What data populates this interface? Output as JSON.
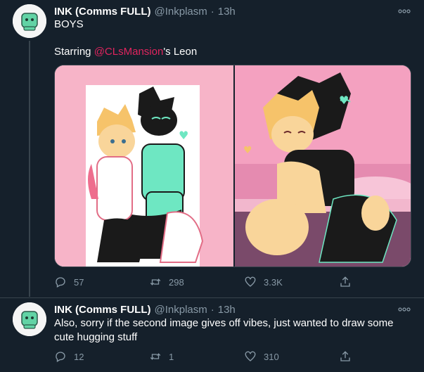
{
  "tweets": [
    {
      "author_name": "INK (Comms FULL)",
      "author_handle": "@Inkplasm",
      "separator": "·",
      "time": "13h",
      "text_line1": "BOYS",
      "text_line2_prefix": "Starring ",
      "mention": "@CLsMansion",
      "text_line2_suffix": "'s Leon",
      "replies": "57",
      "retweets": "298",
      "likes": "3.3K"
    },
    {
      "author_name": "INK (Comms FULL)",
      "author_handle": "@Inkplasm",
      "separator": "·",
      "time": "13h",
      "text": "Also, sorry if the second image gives off vibes, just wanted to draw some cute hugging stuff",
      "replies": "12",
      "retweets": "1",
      "likes": "310"
    }
  ],
  "icons": {
    "more": "more-horizontal-icon",
    "reply": "reply-icon",
    "retweet": "retweet-icon",
    "like": "heart-icon",
    "share": "share-icon"
  },
  "colors": {
    "background": "#15202b",
    "secondary_text": "#8899a6",
    "mention": "#e0245e",
    "divider": "#38444d"
  }
}
